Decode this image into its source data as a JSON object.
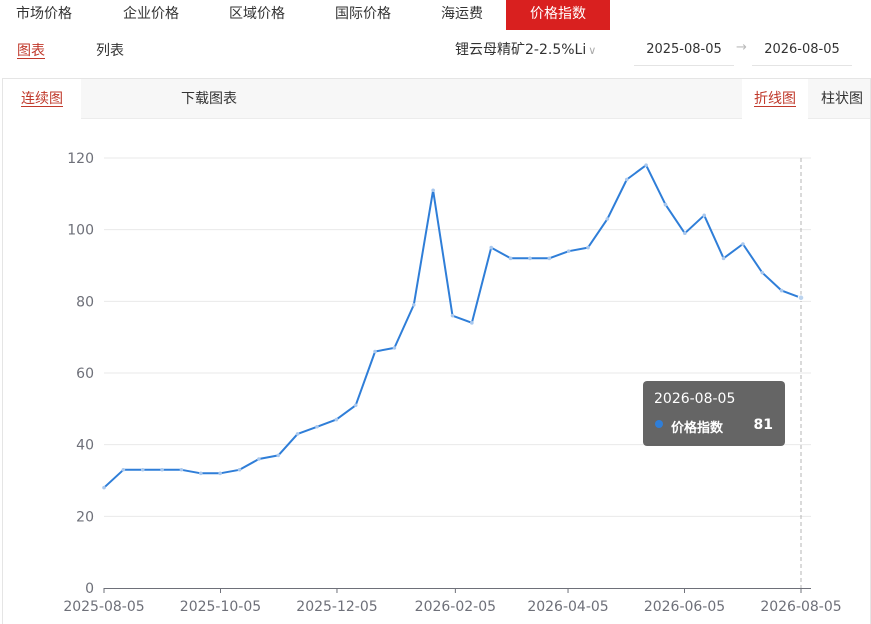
{
  "top_tabs": [
    {
      "label": "市场价格"
    },
    {
      "label": "企业价格"
    },
    {
      "label": "区域价格"
    },
    {
      "label": "国际价格"
    },
    {
      "label": "海运费"
    },
    {
      "label": "价格指数"
    }
  ],
  "sub_tabs": [
    {
      "label": "图表"
    },
    {
      "label": "列表"
    }
  ],
  "product": "锂云母精矿2-2.5%Li",
  "date_start": "2025-08-05",
  "date_end": "2026-08-05",
  "panel": {
    "continuous": "连续图",
    "download": "下载图表",
    "line_chart": "折线图",
    "bar_chart": "柱状图"
  },
  "tooltip": {
    "date": "2026-08-05",
    "series": "价格指数",
    "value": "81"
  },
  "chart_data": {
    "type": "line",
    "x": [
      "2025-08-05",
      "2025-08-19",
      "2025-09-02",
      "2025-09-16",
      "2025-09-30",
      "2025-10-14",
      "2025-10-28",
      "2025-11-11",
      "2025-11-25",
      "2025-12-09",
      "2025-12-23",
      "2026-01-06",
      "2026-01-20",
      "2026-02-03",
      "2026-02-17",
      "2026-03-03",
      "2026-03-17",
      "2026-03-31",
      "2026-04-14",
      "2026-04-28",
      "2026-05-12",
      "2026-05-26",
      "2026-06-09",
      "2026-06-23",
      "2026-07-07",
      "2026-07-21",
      "2026-08-05"
    ],
    "series": [
      {
        "name": "价格指数",
        "color": "#2f7ed8",
        "values": [
          28,
          33,
          33,
          33,
          33,
          32,
          32,
          33,
          36,
          37,
          43,
          45,
          47,
          51,
          66,
          67,
          79,
          111,
          76,
          74,
          95,
          92,
          92,
          92,
          94,
          95,
          103,
          114,
          118,
          107,
          99,
          104,
          92,
          96,
          88,
          83,
          81
        ]
      }
    ],
    "ylim": [
      0,
      120
    ],
    "yticks": [
      0,
      20,
      40,
      60,
      80,
      100,
      120
    ],
    "xticks": [
      "2025-08-05",
      "2025-10-05",
      "2025-12-05",
      "2026-02-05",
      "2026-04-05",
      "2026-06-05",
      "2026-08-05"
    ],
    "grid": true
  }
}
